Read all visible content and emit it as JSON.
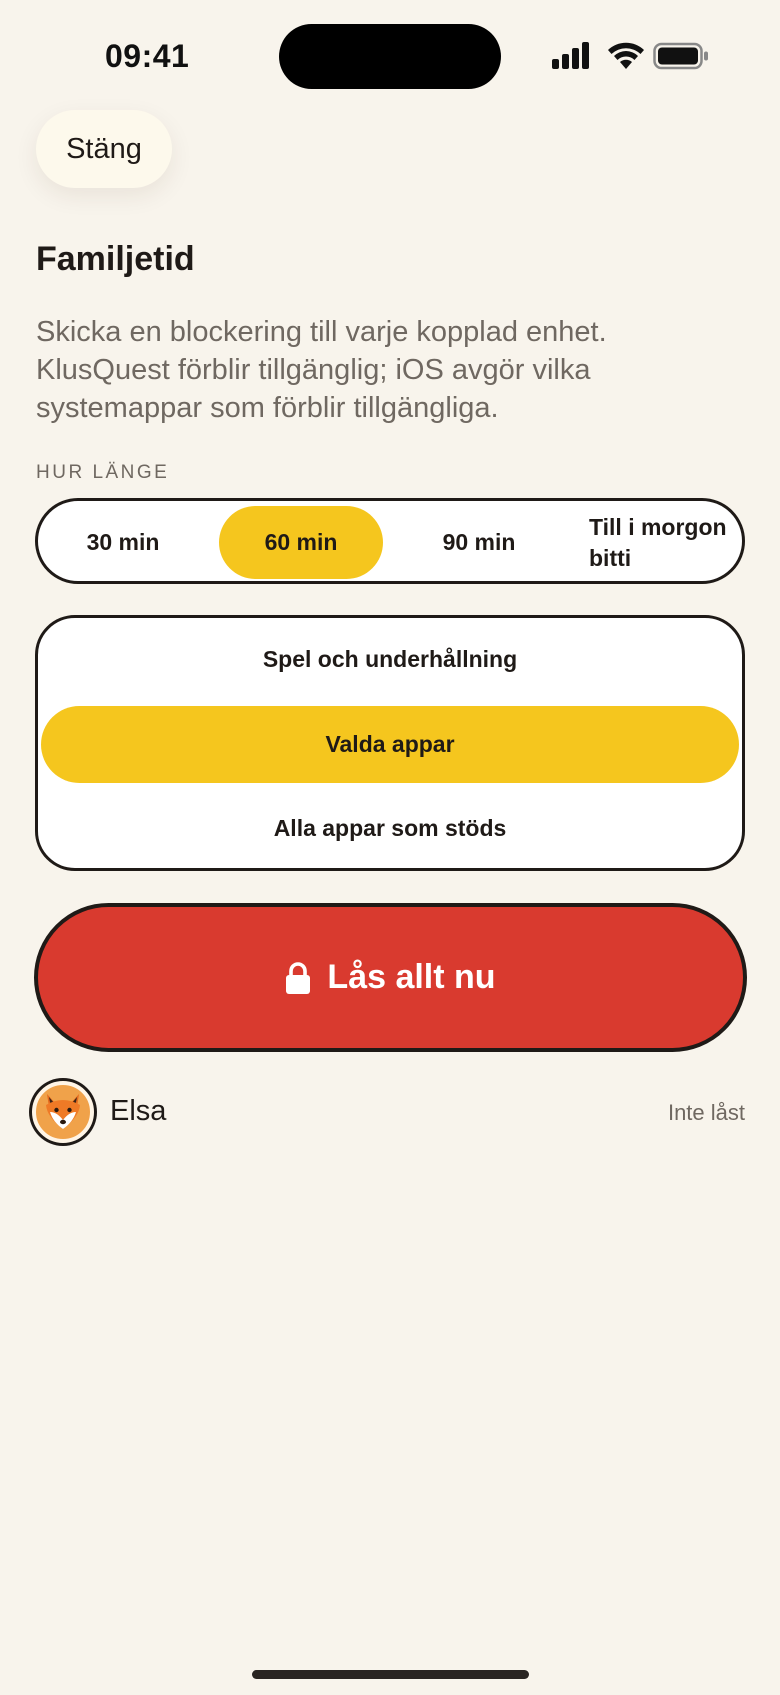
{
  "status_bar": {
    "time": "09:41",
    "icons": [
      "cellular-signal-icon",
      "wifi-icon",
      "battery-icon"
    ]
  },
  "header": {
    "close_label": "Stäng"
  },
  "page": {
    "title": "Familjetid",
    "description": "Skicka en blockering till varje kopplad enhet. KlusQuest förblir tillgänglig; iOS avgör vilka systemappar som förblir tillgängliga."
  },
  "duration": {
    "label": "HUR LÄNGE",
    "options": [
      {
        "label": "30 min",
        "selected": false
      },
      {
        "label": "60 min",
        "selected": true
      },
      {
        "label": "90 min",
        "selected": false
      },
      {
        "label": "Till i morgon bitti",
        "selected": false
      }
    ]
  },
  "scope": {
    "options": [
      {
        "label": "Spel och underhållning",
        "selected": false
      },
      {
        "label": "Valda appar",
        "selected": true
      },
      {
        "label": "Alla appar som stöds",
        "selected": false
      }
    ]
  },
  "lock_button": {
    "label": "Lås allt nu",
    "icon": "lock-icon"
  },
  "children": [
    {
      "name": "Elsa",
      "status": "Inte låst",
      "avatar_icon": "fox-icon"
    }
  ],
  "colors": {
    "background": "#F8F4EC",
    "accent_yellow": "#F5C61E",
    "lock_red": "#D93A2F",
    "text_primary": "#1F1A17",
    "text_secondary": "#6F6861"
  }
}
